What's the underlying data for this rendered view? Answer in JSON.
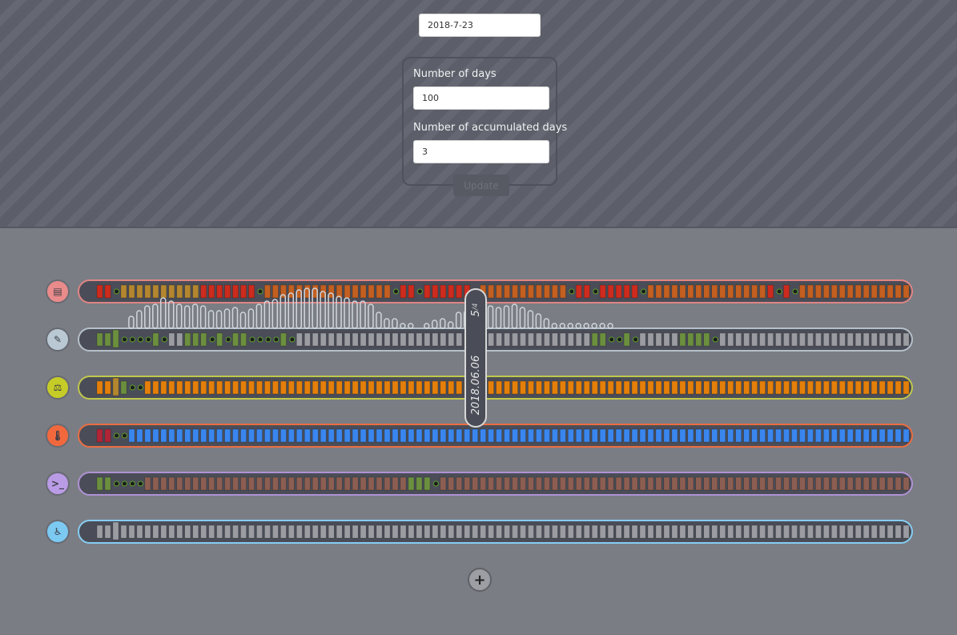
{
  "header": {
    "date_value": "2018-7-23",
    "days_label": "Number of days",
    "days_value": "100",
    "accumulated_label": "Number of accumulated days",
    "accumulated_value": "3",
    "update_label": "Update"
  },
  "marker": {
    "count": "5",
    "count_sub": "/4",
    "date": "2018.06.06"
  },
  "add_label": "+",
  "colors": {
    "empty": "#9a9ca2",
    "dot_border": "#5aa02c"
  },
  "tracks": [
    {
      "name": "film",
      "icon": "film-icon",
      "glyph": "▤",
      "icon_bg": "#e98b8b",
      "border": "#e08585",
      "palette": {
        "r": "#cc2b1e",
        "o": "#c35f20",
        "y": "#b3862f",
        "g": "#6b8f3e",
        "b": "#3a86ee",
        "m": "#8c5e52",
        "e": "#9a9ca2"
      },
      "cells": "rrdyyyyyyyyyyrrrrrrrdoooooooooooooooodrrdrrrrrrdooooooooooodrrdrrrrrdooooooooooooooordrdooooooooooooooooooooooooodrrdoooo"
    },
    {
      "name": "brush",
      "icon": "brush-icon",
      "glyph": "✎",
      "icon_bg": "#b9c8d2",
      "border": "#b5c0c9",
      "palette": {
        "r": "#cc2b1e",
        "o": "#c35f20",
        "y": "#b3862f",
        "g": "#6b8f3e",
        "b": "#3a86ee",
        "m": "#8c5e52",
        "e": "#9a9ca2"
      },
      "cells": "ggTddddgdeegggdgdggddddgdeeeeeeeeeeeeeeeeeeeeeeeeeeeeeeeeeeeeeggddgdeeeeeggggdeeeeeeeeeeeeeeeeeeeeeeeeeeeeeeeeeeeeeee",
      "histogram": [
        [
          4,
          15
        ],
        [
          5,
          22
        ],
        [
          6,
          28
        ],
        [
          7,
          30
        ],
        [
          8,
          38
        ],
        [
          9,
          34
        ],
        [
          10,
          30
        ],
        [
          11,
          28
        ],
        [
          12,
          30
        ],
        [
          13,
          28
        ],
        [
          14,
          22
        ],
        [
          15,
          22
        ],
        [
          16,
          24
        ],
        [
          17,
          26
        ],
        [
          18,
          20
        ],
        [
          19,
          24
        ],
        [
          20,
          30
        ],
        [
          21,
          34
        ],
        [
          22,
          36
        ],
        [
          23,
          42
        ],
        [
          24,
          44
        ],
        [
          25,
          48
        ],
        [
          26,
          50
        ],
        [
          27,
          50
        ],
        [
          28,
          46
        ],
        [
          29,
          44
        ],
        [
          30,
          40
        ],
        [
          31,
          38
        ],
        [
          32,
          34
        ],
        [
          33,
          34
        ],
        [
          34,
          30
        ],
        [
          35,
          20
        ],
        [
          36,
          12
        ],
        [
          37,
          12
        ],
        [
          38,
          6
        ],
        [
          39,
          6
        ],
        [
          41,
          6
        ],
        [
          42,
          10
        ],
        [
          43,
          12
        ],
        [
          44,
          8
        ],
        [
          45,
          20
        ],
        [
          46,
          22
        ],
        [
          47,
          12
        ],
        [
          48,
          22
        ],
        [
          49,
          28
        ],
        [
          50,
          26
        ],
        [
          51,
          28
        ],
        [
          52,
          30
        ],
        [
          53,
          26
        ],
        [
          54,
          22
        ],
        [
          55,
          18
        ],
        [
          56,
          12
        ],
        [
          57,
          6
        ],
        [
          58,
          6
        ],
        [
          59,
          6
        ],
        [
          60,
          6
        ],
        [
          61,
          6
        ],
        [
          62,
          6
        ],
        [
          63,
          6
        ],
        [
          64,
          6
        ]
      ]
    },
    {
      "name": "balance",
      "icon": "balance-icon",
      "glyph": "⚖",
      "icon_bg": "#c6cc27",
      "border": "#c0c84d",
      "palette": {
        "r": "#cc2b1e",
        "o": "#e37f0a",
        "y": "#b3862f",
        "g": "#6b8f3e",
        "b": "#3a86ee",
        "m": "#8c5e52",
        "e": "#9a9ca2"
      },
      "cells": "ooYgddoooooooooooooooooooooooooooooooooooooooooooooooooooooooooooooooooooooooooooooooooooooooooooooooooooooooooooooooooooo"
    },
    {
      "name": "thermometer",
      "icon": "thermometer-icon",
      "glyph": "🌡",
      "icon_bg": "#f2683d",
      "border": "#ea6e42",
      "palette": {
        "r": "#b12437",
        "o": "#c35f20",
        "y": "#b3862f",
        "g": "#6b8f3e",
        "b": "#3a86ee",
        "m": "#8c5e52",
        "e": "#9a9ca2"
      },
      "cells": "rrddbbbbbbbbbbbbbbbbbbbbbbbbbbbbbbbbbbbbbbbbbbbbbbbbbbbbbbbbbbbbbbbbbbbbbbbbbbbbbbbbbbbbbbbbbbbbbbbbbbbbbbbbbbbbbbbbbbbbb"
    },
    {
      "name": "terminal",
      "icon": "terminal-icon",
      "glyph": ">_",
      "icon_bg": "#ba9be6",
      "border": "#b092d4",
      "palette": {
        "r": "#cc2b1e",
        "o": "#c35f20",
        "y": "#b3862f",
        "g": "#6b8f3e",
        "b": "#3a86ee",
        "m": "#8c5e52",
        "e": "#9a9ca2"
      },
      "cells": "ggddddmmmmmmmmmmmmmmmmmmmmmmmmmmmmmmmmmgggdmmmmmmmmmmmmmmmmmmmmmmmmmmmmmmmmmmmmmmmmmmmmmmmmmmmmmmmmmmmmmmmmmmmmmmmmmmmmm"
    },
    {
      "name": "accessibility",
      "icon": "accessibility-icon",
      "glyph": "♿",
      "icon_bg": "#7cc9f2",
      "border": "#86cdf2",
      "palette": {
        "r": "#cc2b1e",
        "o": "#c35f20",
        "y": "#b3862f",
        "g": "#6b8f3e",
        "b": "#3a86ee",
        "m": "#8c5e52",
        "e": "#9a9ca2"
      },
      "cells": "eeEeeeeeeeeeeeeeeeeeeeeeeeeeeeeeeeeeeeeeeeeeeeeeeeeeeeeeeeeeeeeeeeeeeeeeeeeeeeeeeeeeeeeeeeeeeeeeeeeeeeeeeeeeeeeeeeeeeeee"
    }
  ]
}
